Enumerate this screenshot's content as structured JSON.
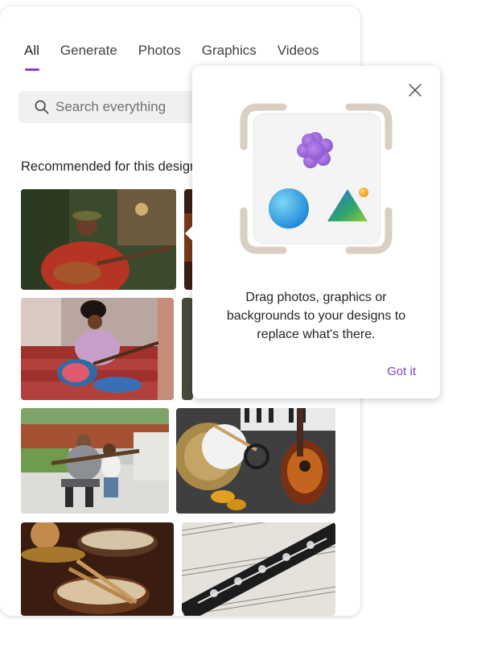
{
  "tabs": [
    {
      "label": "All"
    },
    {
      "label": "Generate"
    },
    {
      "label": "Photos"
    },
    {
      "label": "Graphics"
    },
    {
      "label": "Videos"
    }
  ],
  "active_tab": "All",
  "search": {
    "placeholder": "Search everything"
  },
  "section": {
    "title": "Recommended for this design"
  },
  "thumbnails": [
    {
      "name": "man-playing-guitar-photo",
      "icon": "photo"
    },
    {
      "name": "guitar-closeup-photo",
      "icon": "photo"
    },
    {
      "name": "woman-playing-guitar-on-steps-photo",
      "icon": "photo"
    },
    {
      "name": "music-photo",
      "icon": "photo"
    },
    {
      "name": "grandfather-and-child-guitar-photo",
      "icon": "photo"
    },
    {
      "name": "instruments-flatlay-photo",
      "icon": "photo"
    },
    {
      "name": "drum-kit-photo",
      "icon": "photo"
    },
    {
      "name": "clarinet-sheet-music-photo",
      "icon": "photo"
    }
  ],
  "popup": {
    "text": "Drag photos, graphics or backgrounds to your designs to replace what's there.",
    "button": "Got it",
    "close_icon": "close-icon",
    "illustration_icon": "media-frame-illustration"
  },
  "colors": {
    "accent": "#8a3fc9",
    "text": "#242424",
    "search_bg": "#f0f0f0"
  }
}
